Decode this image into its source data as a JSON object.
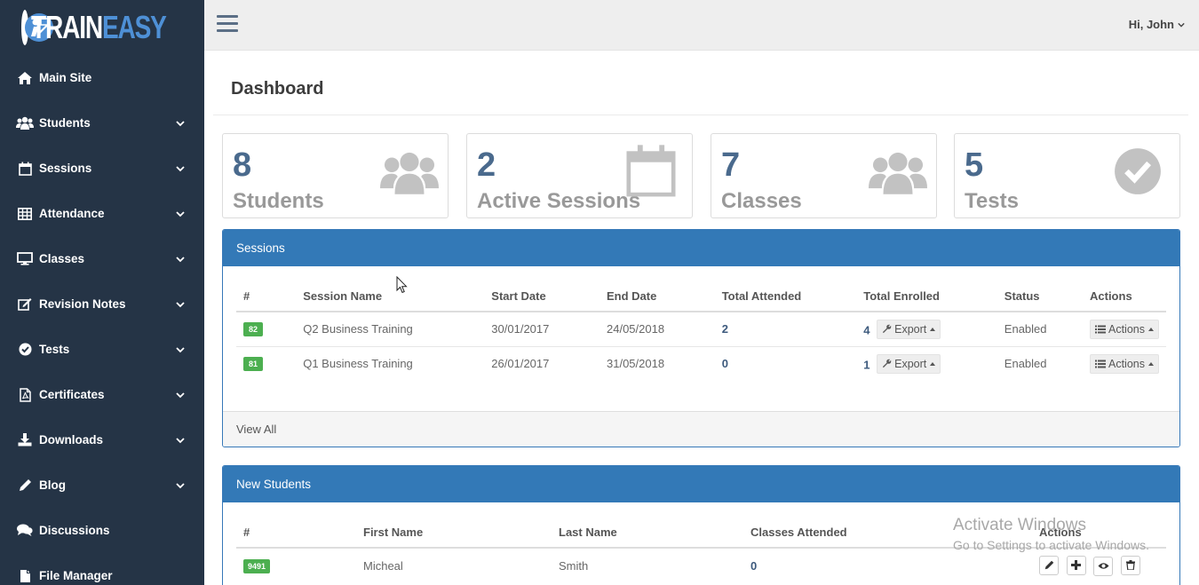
{
  "brand": {
    "part1": "TRAIN",
    "part2": "EASY"
  },
  "sidebar": {
    "items": [
      {
        "label": "Main Site"
      },
      {
        "label": "Students"
      },
      {
        "label": "Sessions"
      },
      {
        "label": "Attendance"
      },
      {
        "label": "Classes"
      },
      {
        "label": "Revision Notes"
      },
      {
        "label": "Tests"
      },
      {
        "label": "Certificates"
      },
      {
        "label": "Downloads"
      },
      {
        "label": "Blog"
      },
      {
        "label": "Discussions"
      },
      {
        "label": "File Manager"
      }
    ]
  },
  "header": {
    "user_greeting": "Hi, John"
  },
  "page": {
    "title": "Dashboard"
  },
  "stats": [
    {
      "value": "8",
      "label": "Students",
      "icon": "users-icon"
    },
    {
      "value": "2",
      "label": "Active Sessions",
      "icon": "calendar-icon"
    },
    {
      "value": "7",
      "label": "Classes",
      "icon": "users-icon"
    },
    {
      "value": "5",
      "label": "Tests",
      "icon": "check-circle-icon"
    }
  ],
  "sessions": {
    "title": "Sessions",
    "columns": [
      "#",
      "Session Name",
      "Start Date",
      "End Date",
      "Total Attended",
      "Total Enrolled",
      "Status",
      "Actions"
    ],
    "rows": [
      {
        "id": "82",
        "name": "Q2 Business Training",
        "start": "30/01/2017",
        "end": "24/05/2018",
        "attended": "2",
        "enrolled": "4",
        "export": "Export",
        "status": "Enabled",
        "actions": "Actions"
      },
      {
        "id": "81",
        "name": "Q1 Business Training",
        "start": "26/01/2017",
        "end": "31/05/2018",
        "attended": "0",
        "enrolled": "1",
        "export": "Export",
        "status": "Enabled",
        "actions": "Actions"
      }
    ],
    "footer": "View All"
  },
  "new_students": {
    "title": "New Students",
    "columns": [
      "#",
      "First Name",
      "Last Name",
      "Classes Attended",
      "Actions"
    ],
    "rows": [
      {
        "id": "9491",
        "first": "Micheal",
        "last": "Smith",
        "classes": "0"
      }
    ]
  },
  "watermark": {
    "line1": "Activate Windows",
    "line2": "Go to Settings to activate Windows."
  },
  "colors": {
    "sidebar": "#253446",
    "panel_header": "#3379b7",
    "accent": "#4e90d6",
    "badge": "#4caf50",
    "stat_number": "#4a6a8d"
  }
}
